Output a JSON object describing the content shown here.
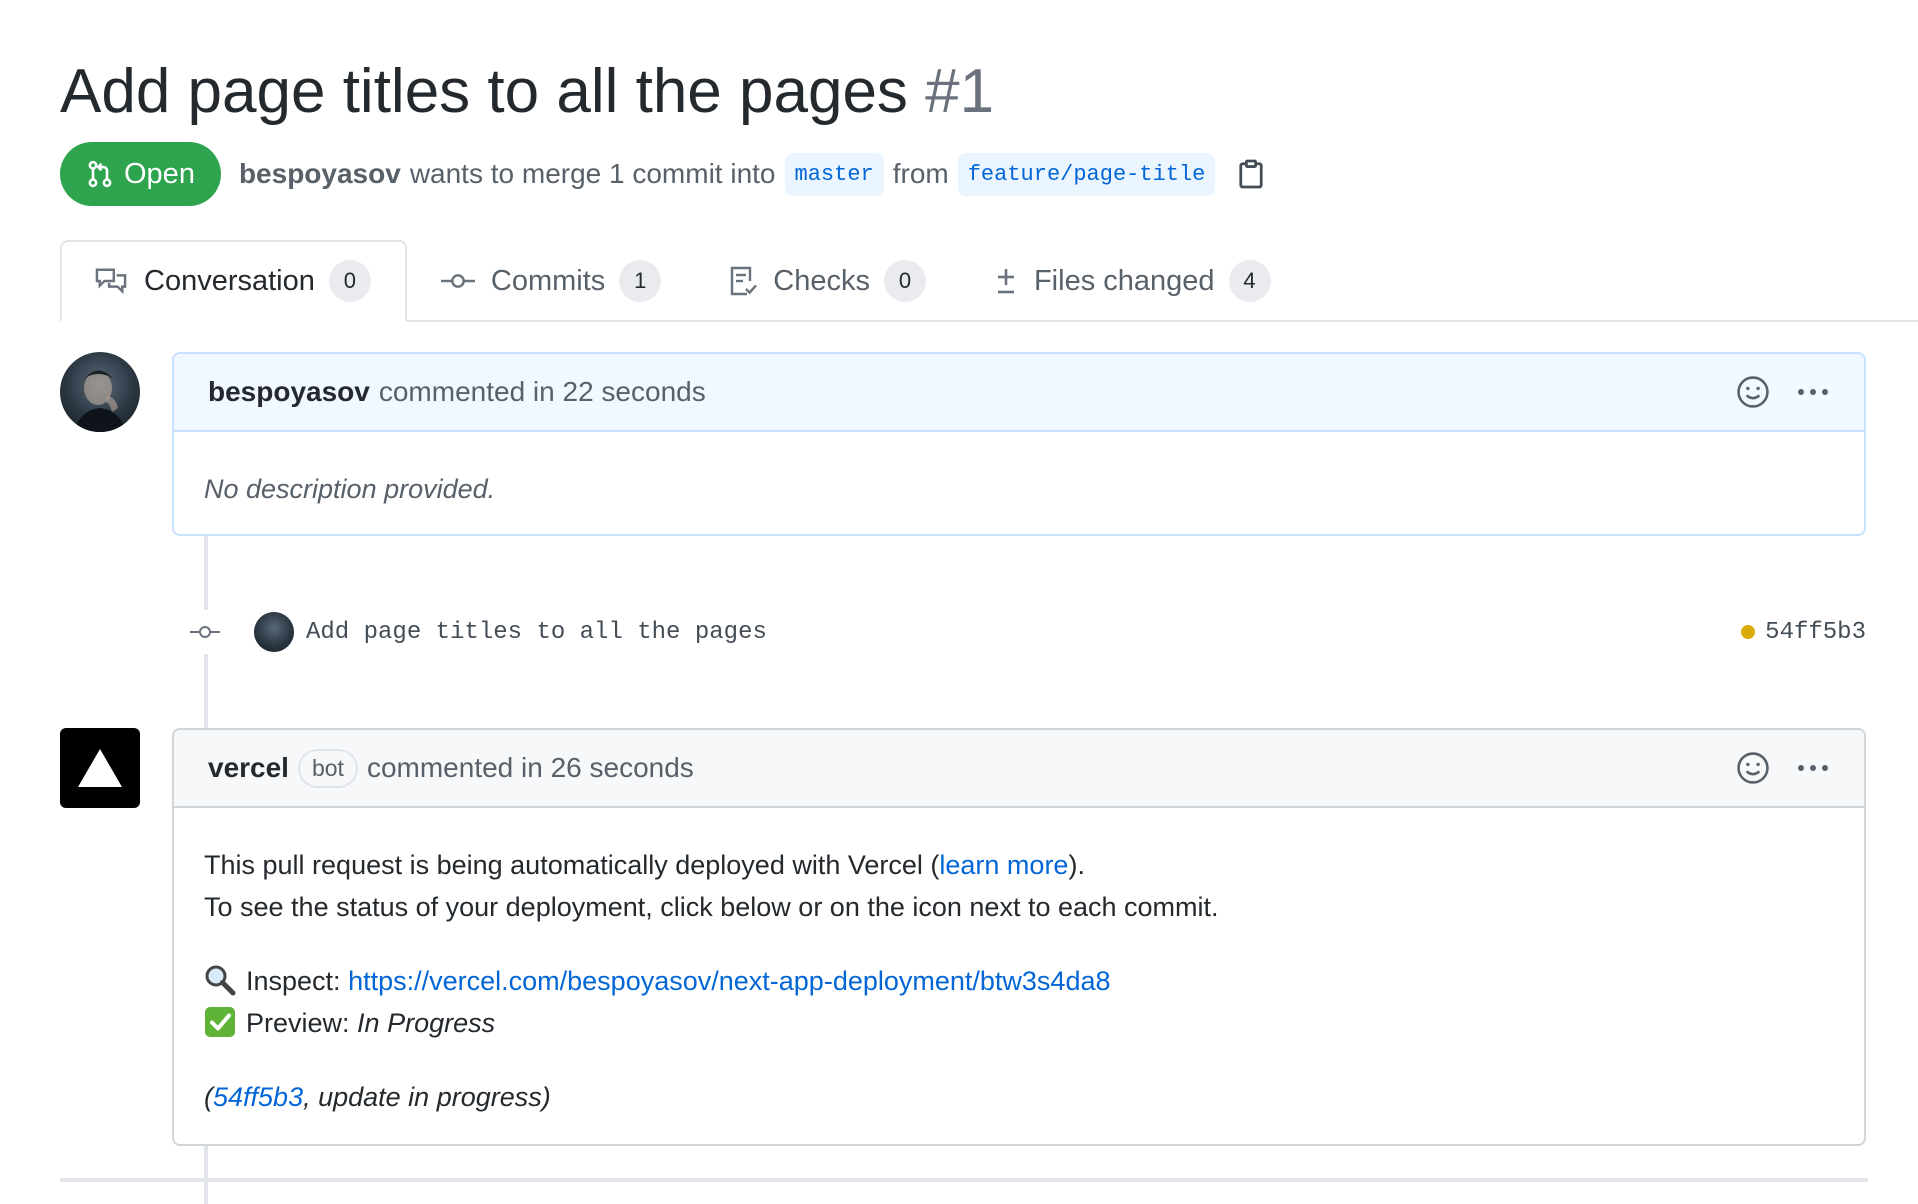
{
  "pr": {
    "title": "Add page titles to all the pages",
    "number": "#1",
    "state": "Open",
    "author": "bespoyasov",
    "merge_text": "wants to merge 1 commit into",
    "base_branch": "master",
    "from_text": "from",
    "head_branch": "feature/page-title"
  },
  "tabs": [
    {
      "label": "Conversation",
      "count": "0",
      "icon": "comment-discussion-icon",
      "selected": true
    },
    {
      "label": "Commits",
      "count": "1",
      "icon": "git-commit-icon"
    },
    {
      "label": "Checks",
      "count": "0",
      "icon": "checklist-icon"
    },
    {
      "label": "Files changed",
      "count": "4",
      "icon": "diff-icon"
    }
  ],
  "comments": [
    {
      "author": "bespoyasov",
      "meta": "commented in 22 seconds",
      "body": "No description provided."
    },
    {
      "author": "vercel",
      "label": "bot",
      "meta": "commented in 26 seconds",
      "line1_prefix": "This pull request is being automatically deployed with Vercel (",
      "line1_link": "learn more",
      "line1_suffix": ").",
      "line2": "To see the status of your deployment, click below or on the icon next to each commit.",
      "inspect_label": "Inspect:",
      "inspect_url": "https://vercel.com/bespoyasov/next-app-deployment/btw3s4da8",
      "preview_label": "Preview:",
      "preview_status": "In Progress",
      "footer_prefix": "(",
      "footer_link": "54ff5b3",
      "footer_suffix": ", update in progress)"
    }
  ],
  "commit": {
    "message": "Add page titles to all the pages",
    "sha": "54ff5b3",
    "status_color": "#dbab09"
  },
  "colors": {
    "open_badge": "#2ea44f",
    "link": "#0366d6"
  }
}
